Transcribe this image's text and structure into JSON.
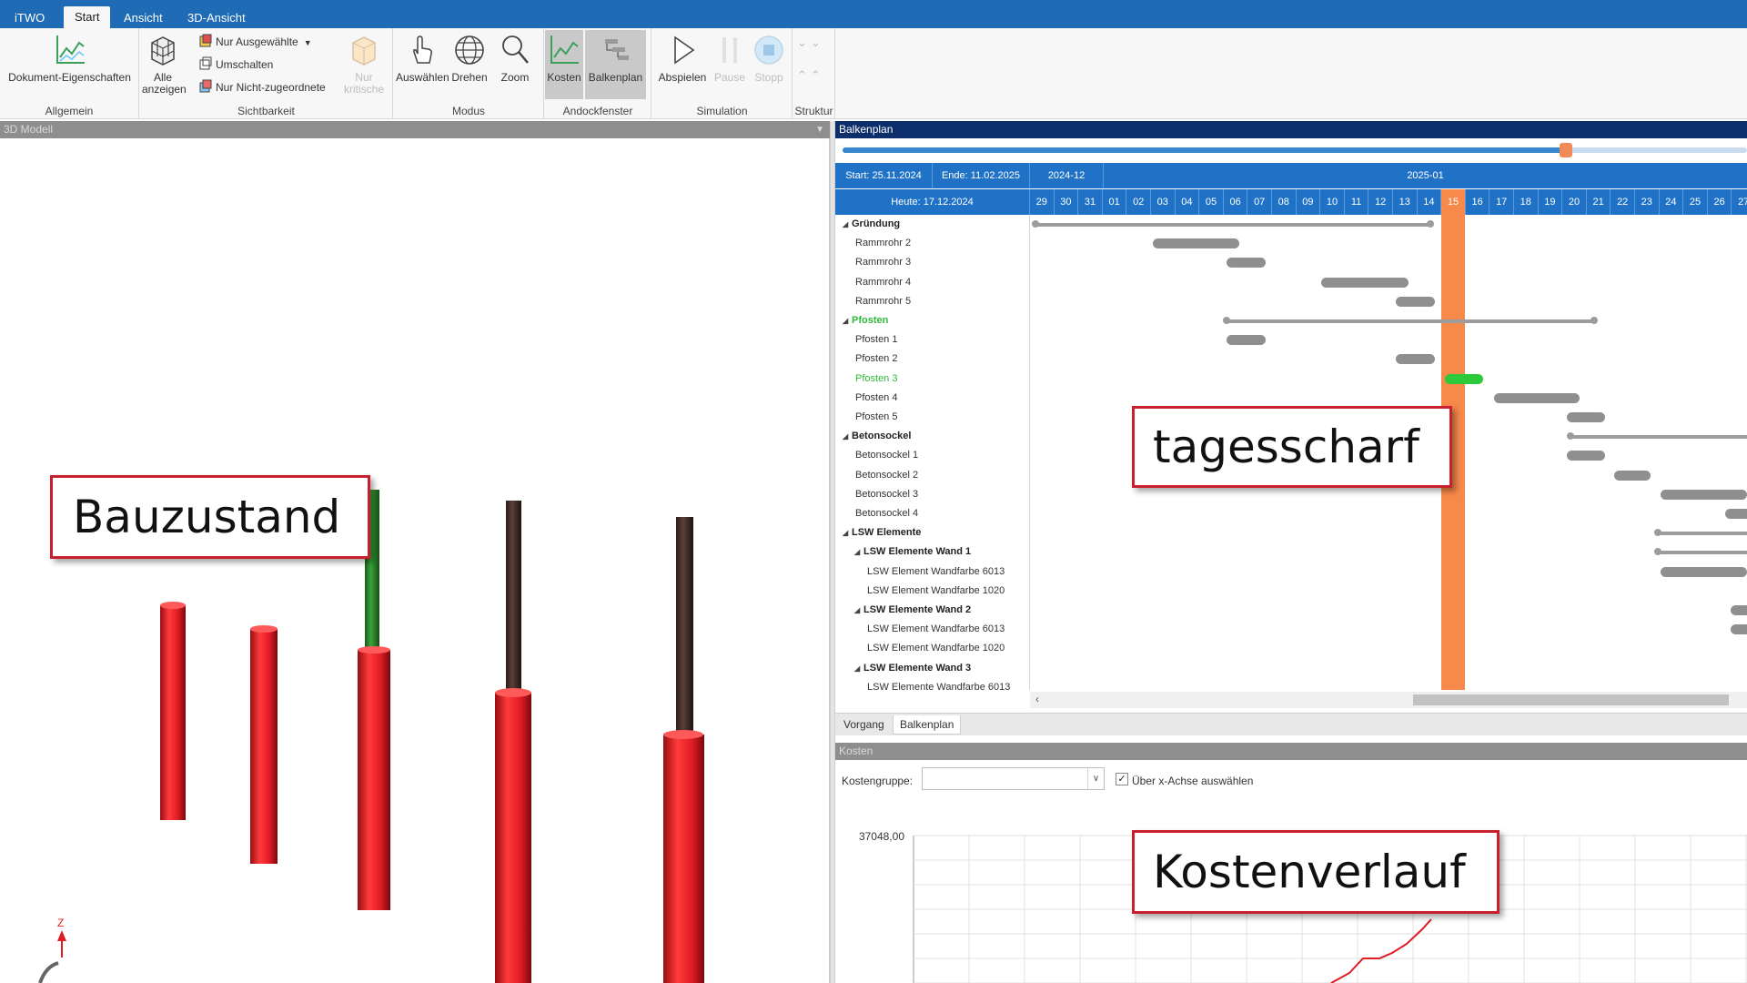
{
  "app": {
    "tabs": [
      {
        "label": "iTWO"
      },
      {
        "label": "Start"
      },
      {
        "label": "Ansicht"
      },
      {
        "label": "3D-Ansicht"
      }
    ],
    "active_tab": "Start"
  },
  "ribbon": {
    "allgemein": {
      "group_label": "Allgemein",
      "doc_props": "Dokument-Eigenschaften"
    },
    "sichtbarkeit": {
      "group_label": "Sichtbarkeit",
      "show_all_line1": "Alle",
      "show_all_line2": "anzeigen",
      "only_selected": "Nur Ausgewählte",
      "toggle": "Umschalten",
      "only_unassigned": "Nur Nicht-zugeordnete",
      "only_critical_line1": "Nur",
      "only_critical_line2": "kritische"
    },
    "modus": {
      "group_label": "Modus",
      "select": "Auswählen",
      "rotate": "Drehen",
      "zoom": "Zoom"
    },
    "andockfenster": {
      "group_label": "Andockfenster",
      "costs": "Kosten",
      "gantt": "Balkenplan"
    },
    "simulation": {
      "group_label": "Simulation",
      "play": "Abspielen",
      "pause": "Pause",
      "stop": "Stopp"
    },
    "struktur": {
      "group_label": "Struktur"
    }
  },
  "model_pane": {
    "title": "3D Modell",
    "axis_label": "Z",
    "colors": {
      "built": "#e01b24",
      "in_progress": "#2e8b2e",
      "planned": "#3a2a28"
    }
  },
  "gantt": {
    "title": "Balkenplan",
    "slider_progress": 0.8,
    "start_label": "Start: 25.11.2024",
    "end_label": "Ende: 11.02.2025",
    "today_label": "Heute: 17.12.2024",
    "month_dec": "2024-12",
    "month_jan": "2025-01",
    "days": [
      "29",
      "30",
      "31",
      "01",
      "02",
      "03",
      "04",
      "05",
      "06",
      "07",
      "08",
      "09",
      "10",
      "11",
      "12",
      "13",
      "14",
      "15",
      "16",
      "17",
      "18",
      "19",
      "20",
      "21",
      "22",
      "23",
      "24",
      "25",
      "26",
      "27"
    ],
    "today_day": "15",
    "rows": [
      {
        "label": "Gründung",
        "level": 0,
        "group": true
      },
      {
        "label": "Rammrohr 2",
        "level": 1
      },
      {
        "label": "Rammrohr 3",
        "level": 1
      },
      {
        "label": "Rammrohr 4",
        "level": 1
      },
      {
        "label": "Rammrohr 5",
        "level": 1
      },
      {
        "label": "Pfosten",
        "level": 0,
        "group": true,
        "active": true
      },
      {
        "label": "Pfosten 1",
        "level": 1
      },
      {
        "label": "Pfosten 2",
        "level": 1
      },
      {
        "label": "Pfosten 3",
        "level": 1,
        "active": true
      },
      {
        "label": "Pfosten 4",
        "level": 1
      },
      {
        "label": "Pfosten 5",
        "level": 1
      },
      {
        "label": "Betonsockel",
        "level": 0,
        "group": true
      },
      {
        "label": "Betonsockel 1",
        "level": 1
      },
      {
        "label": "Betonsockel 2",
        "level": 1
      },
      {
        "label": "Betonsockel 3",
        "level": 1
      },
      {
        "label": "Betonsockel 4",
        "level": 1
      },
      {
        "label": "LSW Elemente",
        "level": 0,
        "group": true
      },
      {
        "label": "LSW Elemente Wand 1",
        "level": 1,
        "group": true
      },
      {
        "label": "LSW Element Wandfarbe 6013",
        "level": 2
      },
      {
        "label": "LSW Element Wandfarbe 1020",
        "level": 2
      },
      {
        "label": "LSW Elemente Wand 2",
        "level": 1,
        "group": true
      },
      {
        "label": "LSW Element Wandfarbe 6013",
        "level": 2
      },
      {
        "label": "LSW Element Wandfarbe 1020",
        "level": 2
      },
      {
        "label": "LSW Elemente Wand 3",
        "level": 1,
        "group": true
      },
      {
        "label": "LSW Elemente Wandfarbe 6013",
        "level": 2
      }
    ],
    "tabs": [
      {
        "label": "Vorgang"
      },
      {
        "label": "Balkenplan"
      }
    ],
    "active_tab": "Balkenplan"
  },
  "costs": {
    "title": "Kosten",
    "group_label": "Kostengruppe:",
    "group_value": "",
    "x_axis_checkbox_label": "Über x-Achse auswählen",
    "x_axis_checked": true
  },
  "chart_data": {
    "type": "line",
    "title": "",
    "xlabel": "",
    "ylabel": "",
    "y_tick_labels": [
      "37048,00"
    ],
    "ylim_max": 37048.0,
    "grid": true
  },
  "callouts": {
    "model": "Bauzustand",
    "gantt": "tagesscharf",
    "costs": "Kostenverlauf"
  }
}
